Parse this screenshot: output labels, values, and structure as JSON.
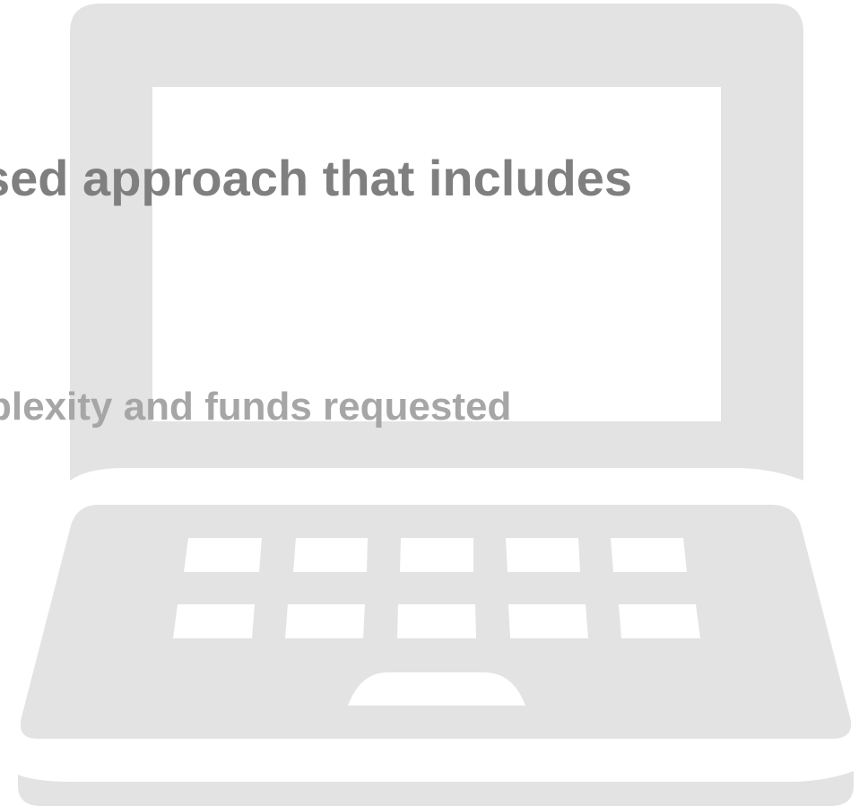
{
  "illustration": {
    "icon": "laptop-icon",
    "color": "#e3e3e3"
  },
  "overlay_text": {
    "line_1": "sed approach that includes",
    "line_1_color": "#7f7f7f",
    "line_2": "plexity and funds requested",
    "line_2_color": "#a6a6a6"
  }
}
